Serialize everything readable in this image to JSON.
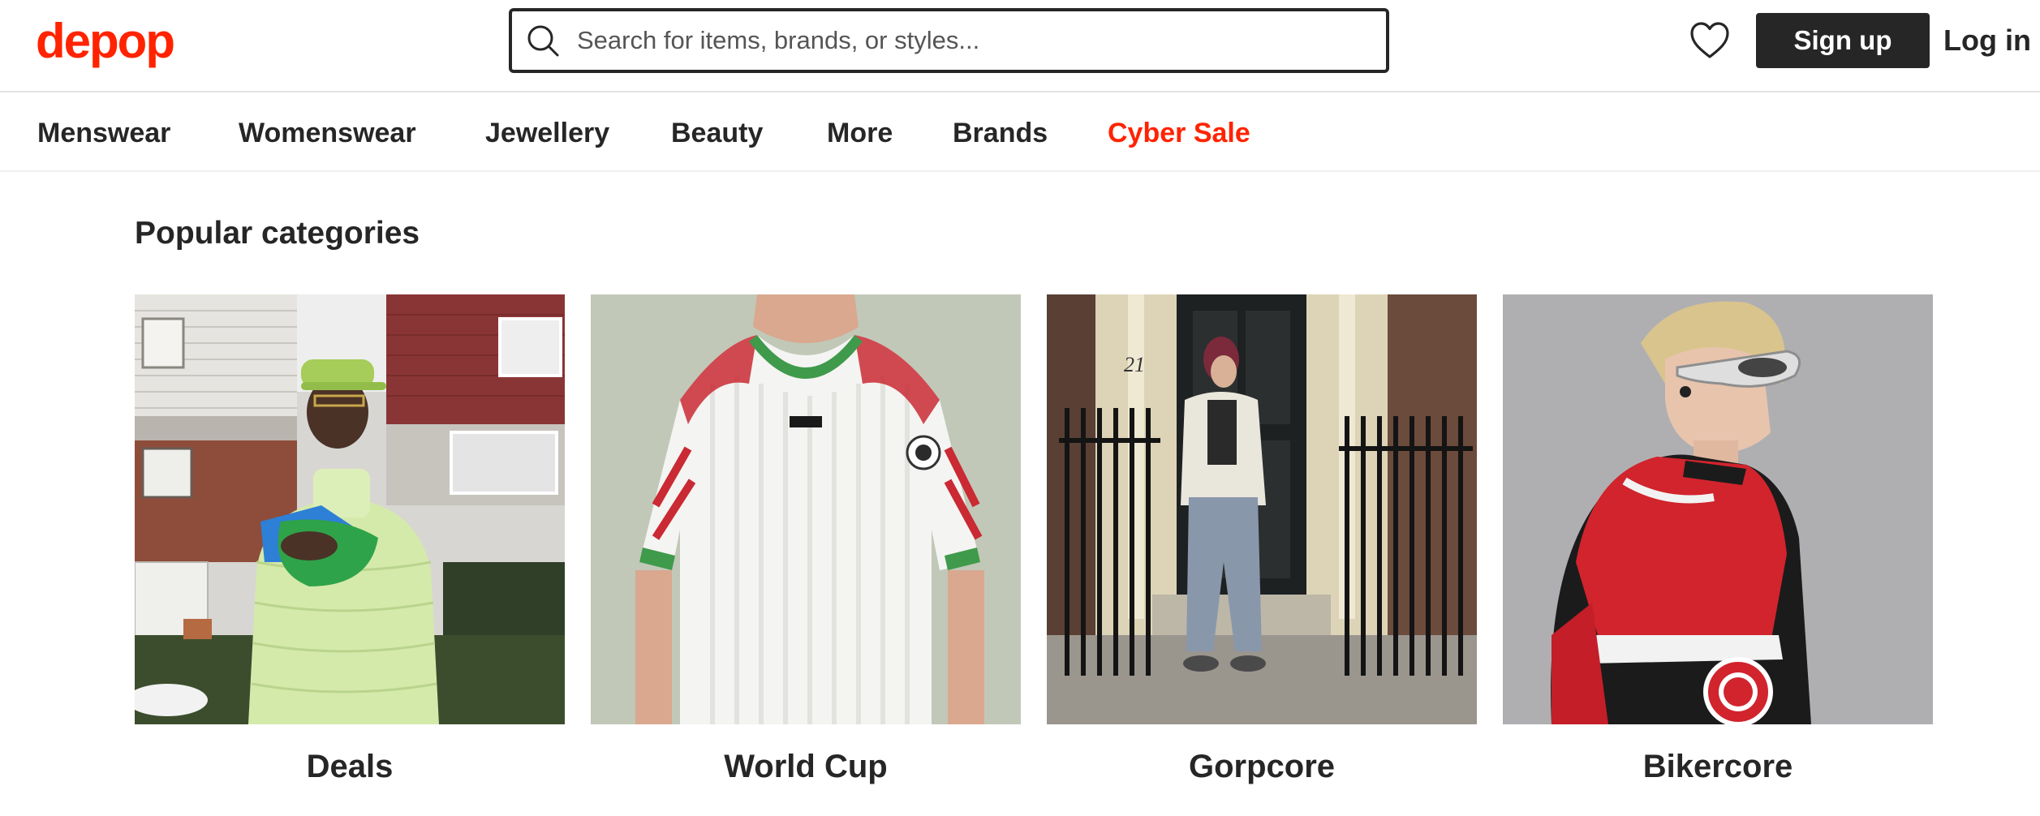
{
  "header": {
    "logo": "depop",
    "search_placeholder": "Search for items, brands, or styles...",
    "signup_label": "Sign up",
    "login_label": "Log in",
    "brand_color": "#ff2300"
  },
  "nav": {
    "items": [
      {
        "label": "Menswear"
      },
      {
        "label": "Womenswear"
      },
      {
        "label": "Jewellery"
      },
      {
        "label": "Beauty"
      },
      {
        "label": "More"
      },
      {
        "label": "Brands"
      },
      {
        "label": "Cyber Sale"
      }
    ]
  },
  "main": {
    "section_title": "Popular categories",
    "categories": [
      {
        "label": "Deals"
      },
      {
        "label": "World Cup"
      },
      {
        "label": "Gorpcore"
      },
      {
        "label": "Bikercore"
      }
    ]
  },
  "icons": {
    "search": "search-icon",
    "favourite": "heart-icon"
  }
}
